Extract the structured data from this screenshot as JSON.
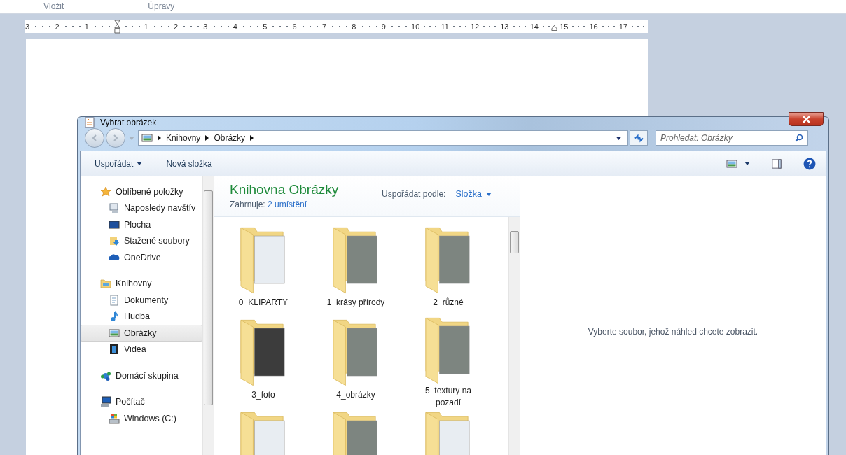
{
  "ribbon": {
    "group_labels": [
      "Vložit",
      "Úpravy"
    ]
  },
  "ruler": {
    "left_labels": [
      "3",
      "2",
      "1"
    ],
    "right_labels": [
      "1",
      "2",
      "3",
      "4",
      "5",
      "6",
      "7",
      "8",
      "9",
      "10",
      "11",
      "12",
      "13",
      "14",
      "15",
      "16",
      "17"
    ]
  },
  "dialog": {
    "title": "Vybrat obrázek",
    "breadcrumb": [
      "Knihovny",
      "Obrázky"
    ],
    "search": {
      "placeholder": "Prohledat: Obrázky"
    },
    "toolbar": {
      "organize": "Uspořádat",
      "new_folder": "Nová složka"
    },
    "nav_tree": [
      {
        "label": "Oblíbené položky",
        "kind": "star",
        "selected": false,
        "children": [
          {
            "label": "Naposledy navštív",
            "kind": "recent",
            "selected": false
          },
          {
            "label": "Plocha",
            "kind": "desktop",
            "selected": false
          },
          {
            "label": "Stažené soubory",
            "kind": "downloads",
            "selected": false
          },
          {
            "label": "OneDrive",
            "kind": "cloud",
            "selected": false
          }
        ]
      },
      {
        "label": "Knihovny",
        "kind": "library",
        "selected": false,
        "children": [
          {
            "label": "Dokumenty",
            "kind": "document",
            "selected": false
          },
          {
            "label": "Hudba",
            "kind": "music",
            "selected": false
          },
          {
            "label": "Obrázky",
            "kind": "pictures",
            "selected": true
          },
          {
            "label": "Videa",
            "kind": "video",
            "selected": false
          }
        ]
      },
      {
        "label": "Domácí skupina",
        "kind": "homegroup",
        "selected": false
      },
      {
        "label": "Počítač",
        "kind": "computer",
        "selected": false,
        "children": [
          {
            "label": "Windows (C:)",
            "kind": "drive",
            "selected": false
          }
        ]
      }
    ],
    "library": {
      "title": "Knihovna Obrázky",
      "includes_label": "Zahrnuje:",
      "includes_link": "2 umístění",
      "arrange_label": "Uspořádat podle:",
      "arrange_value": "Složka"
    },
    "folders": [
      {
        "label": "0_KLIPARTY",
        "kind": "documents"
      },
      {
        "label": "1_krásy přírody",
        "kind": "photos"
      },
      {
        "label": "2_různé",
        "kind": "photos"
      },
      {
        "label": "3_foto",
        "kind": "dark"
      },
      {
        "label": "4_obrázky",
        "kind": "photos"
      },
      {
        "label": "5_textury na pozadí",
        "kind": "photos"
      },
      {
        "kind": "documents"
      },
      {
        "kind": "photos"
      },
      {
        "kind": "documents"
      }
    ],
    "preview": {
      "message": "Vyberte soubor, jehož náhled chcete zobrazit."
    }
  }
}
